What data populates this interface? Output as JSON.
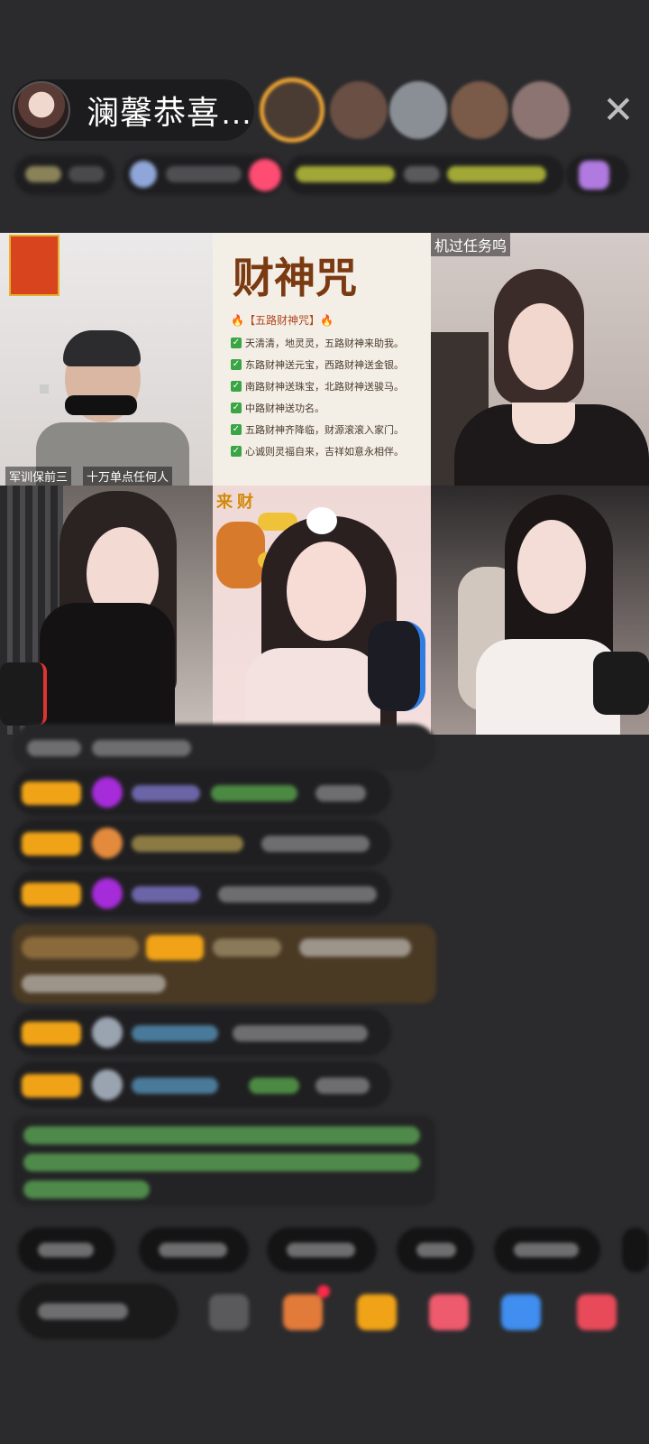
{
  "header": {
    "host_name": "澜馨恭喜…",
    "close_icon": "close-icon"
  },
  "grid": {
    "cell1_label_left": "军训保前三",
    "cell1_label_right": "十万单点任何人",
    "cell2": {
      "title": "财神咒",
      "subtitle": "🔥【五路财神咒】🔥",
      "lines": [
        "天清清，地灵灵，五路财神来助我。",
        "东路财神送元宝，西路财神送金银。",
        "南路财神送珠宝，北路财神送骏马。",
        "中路财神送功名。",
        "五路财神齐降临，财源滚滚入家门。",
        "心诚则灵福自来，吉祥如意永相伴。"
      ]
    },
    "cell3_label": "机过任务呜",
    "cell5_label": "来 财"
  },
  "colors": {
    "background": "#2b2b2d",
    "badge": "#f0a317",
    "gift_frame": "#e8a033"
  }
}
